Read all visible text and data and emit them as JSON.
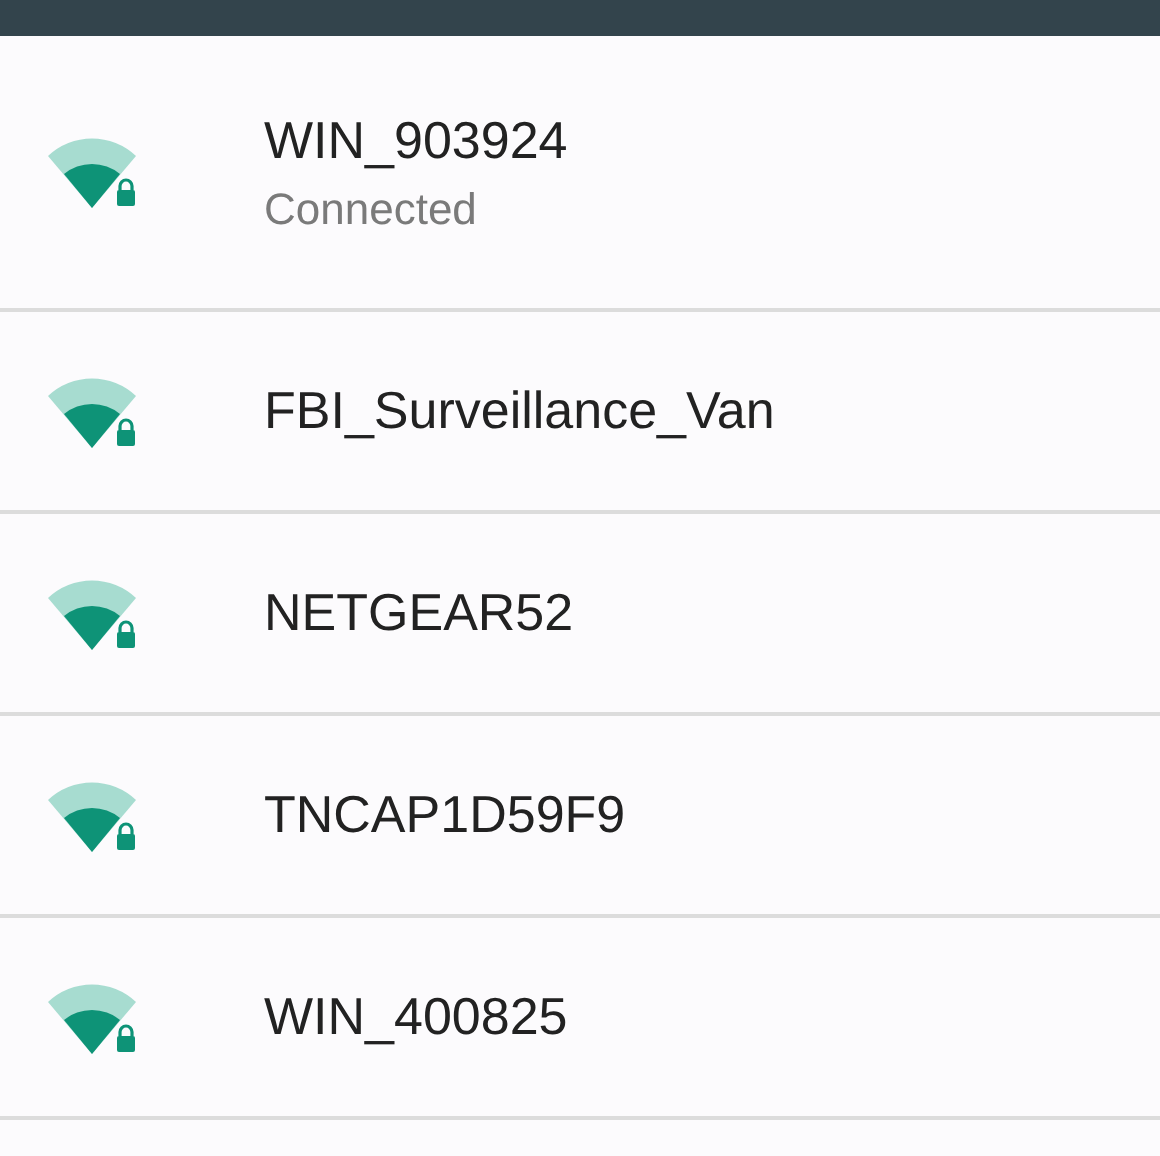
{
  "networks": [
    {
      "name": "WIN_903924",
      "status": "Connected",
      "locked": true
    },
    {
      "name": "FBI_Surveillance_Van",
      "locked": true
    },
    {
      "name": "NETGEAR52",
      "locked": true
    },
    {
      "name": "TNCAP1D59F9",
      "locked": true
    },
    {
      "name": "WIN_400825",
      "locked": true
    }
  ]
}
